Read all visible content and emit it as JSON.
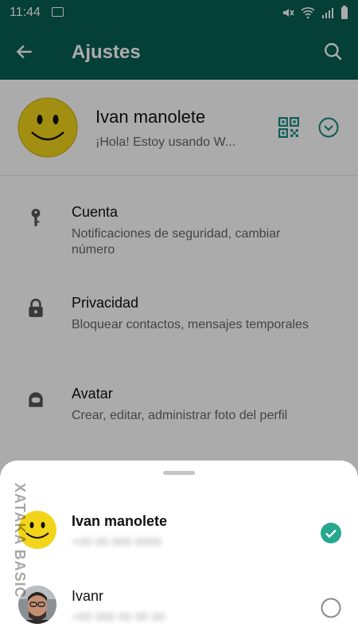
{
  "status_bar": {
    "time": "11:44"
  },
  "app_bar": {
    "title": "Ajustes"
  },
  "profile": {
    "name": "Ivan manolete",
    "status": "¡Hola! Estoy usando W..."
  },
  "settings": [
    {
      "title": "Cuenta",
      "subtitle": "Notificaciones de seguridad, cambiar número",
      "icon": "key-icon"
    },
    {
      "title": "Privacidad",
      "subtitle": "Bloquear contactos, mensajes temporales",
      "icon": "lock-icon"
    },
    {
      "title": "Avatar",
      "subtitle": "Crear, editar, administrar foto del perfil",
      "icon": "avatar-icon"
    }
  ],
  "account_sheet": {
    "accounts": [
      {
        "name": "Ivan manolete",
        "number": "+00 00 000 0000",
        "selected": true
      },
      {
        "name": "Ivanr",
        "number": "+00 000 00 00 00",
        "selected": false
      }
    ]
  },
  "watermark": "XATAKA BASIC",
  "colors": {
    "primary": "#075e54",
    "accent": "#128c7e",
    "check": "#25a88f"
  }
}
